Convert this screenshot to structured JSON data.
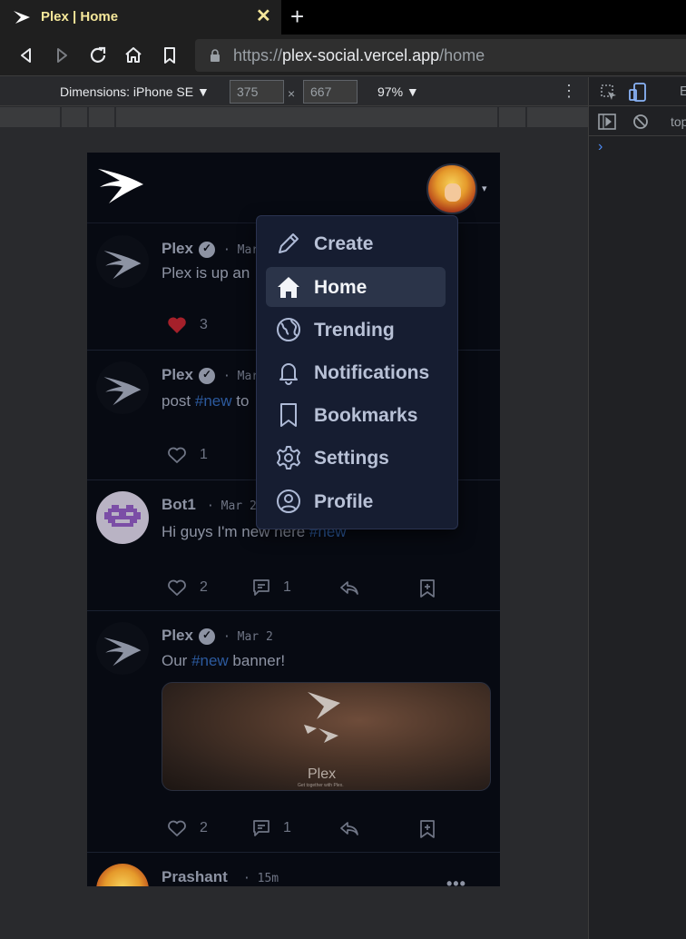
{
  "browser": {
    "tab_title": "Plex | Home",
    "tab_close": "✕",
    "new_tab": "+",
    "url_scheme": "https://",
    "url_host": "plex-social.vercel.app",
    "url_path": "/home"
  },
  "device_toolbar": {
    "dimensions_label": "Dimensions: iPhone SE ▼",
    "width": "375",
    "height": "667",
    "times": "×",
    "zoom": "97% ▼",
    "more": "⋮"
  },
  "devtools": {
    "context": "top",
    "prompt": "›",
    "partial_tab": "E"
  },
  "app": {
    "logo": "plex-logo-icon",
    "avatar_caret": "▾"
  },
  "menu": {
    "items": [
      {
        "label": "Create",
        "icon": "pencil-icon",
        "active": false
      },
      {
        "label": "Home",
        "icon": "home-icon",
        "active": true
      },
      {
        "label": "Trending",
        "icon": "globe-icon",
        "active": false
      },
      {
        "label": "Notifications",
        "icon": "bell-icon",
        "active": false
      },
      {
        "label": "Bookmarks",
        "icon": "bookmark-icon",
        "active": false
      },
      {
        "label": "Settings",
        "icon": "gear-icon",
        "active": false
      },
      {
        "label": "Profile",
        "icon": "user-circle-icon",
        "active": false
      }
    ]
  },
  "posts": [
    {
      "name": "Plex",
      "verified": true,
      "date": "· Mar",
      "text": "Plex is up an",
      "likes": "3",
      "liked": true
    },
    {
      "name": "Plex",
      "verified": true,
      "date": "· Mar",
      "text_before": "post ",
      "tag": "#new",
      "text_after": " to",
      "likes": "1"
    },
    {
      "name": "Bot1",
      "verified": false,
      "date": "· Mar 2",
      "text_before": "Hi guys I'm new here ",
      "tag": "#new",
      "likes": "2",
      "comments": "1"
    },
    {
      "name": "Plex",
      "verified": true,
      "date": "· Mar 2",
      "text_before": "Our ",
      "tag": "#new",
      "text_after": " banner!",
      "banner_brand": "Plex",
      "banner_tagline": "Get together with Plex.",
      "likes": "2",
      "comments": "1"
    },
    {
      "name": "Prashant",
      "verified": false,
      "date": "· 15m"
    }
  ]
}
